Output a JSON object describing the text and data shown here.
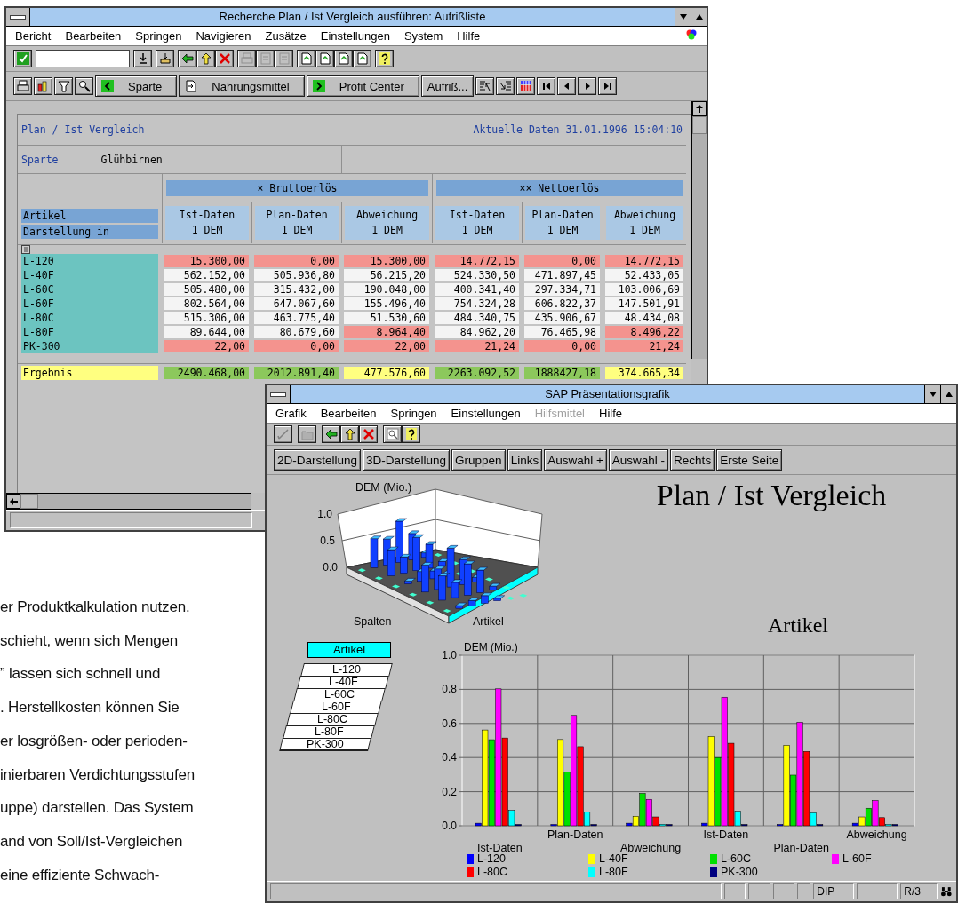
{
  "report_window": {
    "title": "Recherche Plan / Ist Vergleich ausführen: Aufrißliste",
    "menu": [
      {
        "label": "Bericht",
        "disabled": false
      },
      {
        "label": "Bearbeiten",
        "disabled": false
      },
      {
        "label": "Springen",
        "disabled": false
      },
      {
        "label": "Navigieren",
        "disabled": false
      },
      {
        "label": "Zusätze",
        "disabled": false
      },
      {
        "label": "Einstellungen",
        "disabled": false
      },
      {
        "label": "System",
        "disabled": false
      },
      {
        "label": "Hilfe",
        "disabled": false
      }
    ],
    "nav_buttons": [
      {
        "label": "Sparte",
        "kind": "back"
      },
      {
        "label": "Nahrungsmittel",
        "kind": "doc"
      },
      {
        "label": "Profit Center",
        "kind": "forward"
      },
      {
        "label": "Aufriß...",
        "kind": "plain"
      }
    ],
    "report": {
      "title": "Plan / Ist Vergleich",
      "timestamp": "Aktuelle Daten 31.01.1996 15:04:10",
      "filter_label": "Sparte",
      "filter_value": "Glühbirnen",
      "groups": [
        "× Bruttoerlös",
        "×× Nettoerlös"
      ],
      "row_header": [
        "Artikel",
        "Darstellung in"
      ],
      "columns": [
        {
          "name": "Ist-Daten",
          "unit": "1 DEM"
        },
        {
          "name": "Plan-Daten",
          "unit": "1 DEM"
        },
        {
          "name": "Abweichung",
          "unit": "1 DEM"
        },
        {
          "name": "Ist-Daten",
          "unit": "1 DEM"
        },
        {
          "name": "Plan-Daten",
          "unit": "1 DEM"
        },
        {
          "name": "Abweichung",
          "unit": "1 DEM"
        }
      ],
      "rows": [
        {
          "label": "L-120",
          "cells": [
            {
              "text": "15.300,00",
              "color": "#f4938e"
            },
            {
              "text": "0,00",
              "color": "#f4938e"
            },
            {
              "text": "15.300,00",
              "color": "#f4938e"
            },
            {
              "text": "14.772,15",
              "color": "#f4938e"
            },
            {
              "text": "0,00",
              "color": "#f4938e"
            },
            {
              "text": "14.772,15",
              "color": "#f4938e"
            }
          ]
        },
        {
          "label": "L-40F",
          "cells": [
            {
              "text": "562.152,00",
              "color": "#f4f4f4"
            },
            {
              "text": "505.936,80",
              "color": "#f4f4f4"
            },
            {
              "text": "56.215,20",
              "color": "#f4f4f4"
            },
            {
              "text": "524.330,50",
              "color": "#f4f4f4"
            },
            {
              "text": "471.897,45",
              "color": "#f4f4f4"
            },
            {
              "text": "52.433,05",
              "color": "#f4f4f4"
            }
          ]
        },
        {
          "label": "L-60C",
          "cells": [
            {
              "text": "505.480,00",
              "color": "#f4f4f4"
            },
            {
              "text": "315.432,00",
              "color": "#f4f4f4"
            },
            {
              "text": "190.048,00",
              "color": "#f4f4f4"
            },
            {
              "text": "400.341,40",
              "color": "#f4f4f4"
            },
            {
              "text": "297.334,71",
              "color": "#f4f4f4"
            },
            {
              "text": "103.006,69",
              "color": "#f4f4f4"
            }
          ]
        },
        {
          "label": "L-60F",
          "cells": [
            {
              "text": "802.564,00",
              "color": "#f4f4f4"
            },
            {
              "text": "647.067,60",
              "color": "#f4f4f4"
            },
            {
              "text": "155.496,40",
              "color": "#f4f4f4"
            },
            {
              "text": "754.324,28",
              "color": "#f4f4f4"
            },
            {
              "text": "606.822,37",
              "color": "#f4f4f4"
            },
            {
              "text": "147.501,91",
              "color": "#f4f4f4"
            }
          ]
        },
        {
          "label": "L-80C",
          "cells": [
            {
              "text": "515.306,00",
              "color": "#f4f4f4"
            },
            {
              "text": "463.775,40",
              "color": "#f4f4f4"
            },
            {
              "text": "51.530,60",
              "color": "#f4f4f4"
            },
            {
              "text": "484.340,75",
              "color": "#f4f4f4"
            },
            {
              "text": "435.906,67",
              "color": "#f4f4f4"
            },
            {
              "text": "48.434,08",
              "color": "#f4f4f4"
            }
          ]
        },
        {
          "label": "L-80F",
          "cells": [
            {
              "text": "89.644,00",
              "color": "#f4f4f4"
            },
            {
              "text": "80.679,60",
              "color": "#f4f4f4"
            },
            {
              "text": "8.964,40",
              "color": "#f4938e"
            },
            {
              "text": "84.962,20",
              "color": "#f4f4f4"
            },
            {
              "text": "76.465,98",
              "color": "#f4f4f4"
            },
            {
              "text": "8.496,22",
              "color": "#f4938e"
            }
          ]
        },
        {
          "label": "PK-300",
          "cells": [
            {
              "text": "22,00",
              "color": "#f4938e"
            },
            {
              "text": "0,00",
              "color": "#f4938e"
            },
            {
              "text": "22,00",
              "color": "#f4938e"
            },
            {
              "text": "21,24",
              "color": "#f4938e"
            },
            {
              "text": "0,00",
              "color": "#f4938e"
            },
            {
              "text": "21,24",
              "color": "#f4938e"
            }
          ]
        }
      ],
      "total": {
        "label": "Ergebnis",
        "cells": [
          {
            "text": "2490.468,00",
            "color": "#8cc85c"
          },
          {
            "text": "2012.891,40",
            "color": "#8cc85c"
          },
          {
            "text": "477.576,60",
            "color": "#ffff80"
          },
          {
            "text": "2263.092,52",
            "color": "#8cc85c"
          },
          {
            "text": "1888427,18",
            "color": "#8cc85c"
          },
          {
            "text": "374.665,34",
            "color": "#ffff80"
          }
        ]
      }
    }
  },
  "graphics_window": {
    "title": "SAP Präsentationsgrafik",
    "menu": [
      {
        "label": "Grafik",
        "disabled": false
      },
      {
        "label": "Bearbeiten",
        "disabled": false
      },
      {
        "label": "Springen",
        "disabled": false
      },
      {
        "label": "Einstellungen",
        "disabled": false
      },
      {
        "label": "Hilfsmittel",
        "disabled": true
      },
      {
        "label": "Hilfe",
        "disabled": false
      }
    ],
    "buttons": [
      "2D-Darstellung",
      "3D-Darstellung",
      "Gruppen",
      "Links",
      "Auswahl +",
      "Auswahl -",
      "Rechts",
      "Erste Seite"
    ],
    "chart_3d": {
      "ylabel": "DEM (Mio.)",
      "yticks": [
        "1.0",
        "0.5",
        "0.0"
      ],
      "xlabel": "Spalten",
      "zlabel": "Artikel"
    },
    "heading": "Plan / Ist Vergleich",
    "subheading": "Artikel",
    "legend_list": {
      "header": "Artikel",
      "items": [
        "L-120",
        "L-40F",
        "L-60C",
        "L-60F",
        "L-80C",
        "L-80F",
        "PK-300"
      ]
    },
    "chart_data": {
      "type": "bar",
      "grid": true,
      "ylabel": "DEM (Mio.)",
      "categories": [
        "Ist-Daten",
        "Plan-Daten",
        "Abweichung",
        "Ist-Daten",
        "Plan-Daten",
        "Abweichung"
      ],
      "ylim": [
        0,
        1
      ],
      "yticks": [
        {
          "value": 0,
          "label": "0.0"
        },
        {
          "value": 0.2,
          "label": "0.2"
        },
        {
          "value": 0.4,
          "label": "0.4"
        },
        {
          "value": 0.6,
          "label": "0.6"
        },
        {
          "value": 0.8,
          "label": "0.8"
        },
        {
          "value": 1,
          "label": "1.0"
        }
      ],
      "series": [
        {
          "name": "L-120",
          "color": "#0000ff",
          "values": [
            0.015,
            0,
            0.015,
            0.015,
            0,
            0.015
          ]
        },
        {
          "name": "L-40F",
          "color": "#ffff00",
          "values": [
            0.562,
            0.506,
            0.056,
            0.524,
            0.472,
            0.052
          ]
        },
        {
          "name": "L-60C",
          "color": "#00e000",
          "values": [
            0.505,
            0.315,
            0.19,
            0.4,
            0.297,
            0.103
          ]
        },
        {
          "name": "L-60F",
          "color": "#ff00ff",
          "values": [
            0.803,
            0.647,
            0.155,
            0.754,
            0.607,
            0.148
          ]
        },
        {
          "name": "L-80C",
          "color": "#ff0000",
          "values": [
            0.515,
            0.464,
            0.052,
            0.484,
            0.436,
            0.048
          ]
        },
        {
          "name": "L-80F",
          "color": "#00ffff",
          "values": [
            0.09,
            0.081,
            0.009,
            0.085,
            0.076,
            0.008
          ]
        },
        {
          "name": "PK-300",
          "color": "#000080",
          "values": [
            0,
            0,
            0,
            0,
            0,
            0
          ]
        }
      ]
    },
    "status_bar": [
      "DIP",
      "R/3"
    ]
  },
  "page_text": [
    "er Produktkalkulation nutzen.",
    "schieht, wenn sich Mengen",
    "” lassen sich schnell und",
    ". Herstellkosten können Sie",
    "er losgrößen- oder perioden-",
    "inierbaren Verdichtungsstufen",
    "uppe) darstellen. Das System",
    "and von Soll/Ist-Vergleichen",
    "eine effiziente Schwach-"
  ]
}
